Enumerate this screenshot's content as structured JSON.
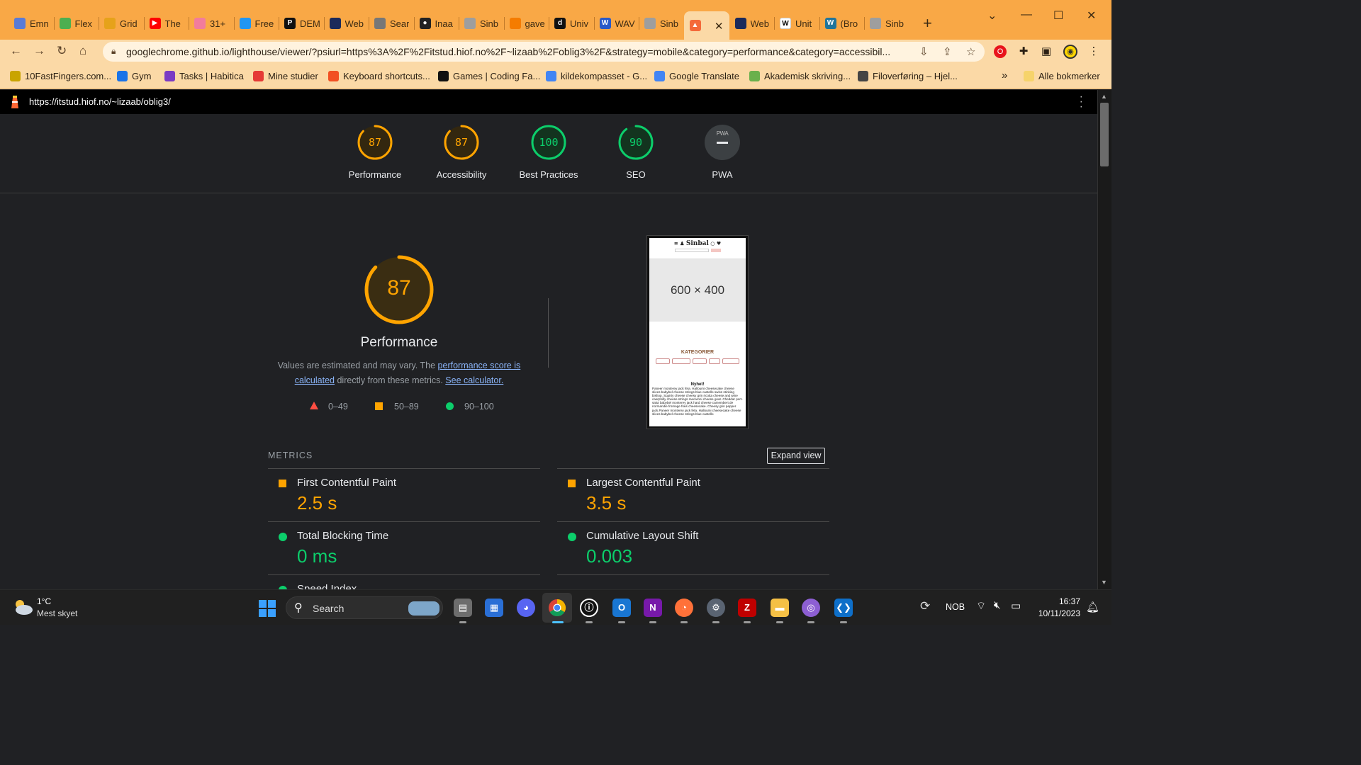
{
  "browser": {
    "tabs": [
      {
        "label": "Emn",
        "icon": "tab-favicon-emn"
      },
      {
        "label": "Flex",
        "icon": "tab-favicon-flex"
      },
      {
        "label": "Grid",
        "icon": "tab-favicon-grid"
      },
      {
        "label": "The",
        "icon": "youtube-icon"
      },
      {
        "label": "31+",
        "icon": "tab-favicon-pin"
      },
      {
        "label": "Free",
        "icon": "tab-favicon-free"
      },
      {
        "label": "DEM",
        "icon": "tab-favicon-dem"
      },
      {
        "label": "Web",
        "icon": "tab-favicon-web"
      },
      {
        "label": "Sear",
        "icon": "tab-favicon-search"
      },
      {
        "label": "Inaa",
        "icon": "github-icon"
      },
      {
        "label": "Sinb",
        "icon": "globe-icon"
      },
      {
        "label": "gave",
        "icon": "tab-favicon-trend"
      },
      {
        "label": "Univ",
        "icon": "tab-favicon-d"
      },
      {
        "label": "WAV",
        "icon": "tab-favicon-wav"
      },
      {
        "label": "Sinb",
        "icon": "globe-icon"
      },
      {
        "label": "",
        "icon": "lighthouse-icon"
      },
      {
        "label": "Web",
        "icon": "tab-favicon-web"
      },
      {
        "label": "Unit",
        "icon": "wikipedia-icon"
      },
      {
        "label": "(Bro",
        "icon": "wordpress-icon"
      },
      {
        "label": "Sinb",
        "icon": "globe-icon"
      }
    ],
    "active_tab_close": "✕",
    "new_tab": "+",
    "address": "googlechrome.github.io/lighthouse/viewer/?psiurl=https%3A%2F%2Fitstud.hiof.no%2F~lizaab%2Foblig3%2F&strategy=mobile&category=performance&category=accessibil...",
    "bookmarks": [
      "10FastFingers.com...",
      "Gym",
      "Tasks | Habitica",
      "Mine studier",
      "Keyboard shortcuts...",
      "Games | Coding Fa...",
      "kildekompasset - G...",
      "Google Translate",
      "Akademisk skriving...",
      "Filoverføring – Hjel..."
    ],
    "bookmarks_overflow": "»",
    "all_bookmarks": "Alle bokmerker"
  },
  "lighthouse": {
    "tested_url": "https://itstud.hiof.no/~lizaab/oblig3/",
    "categories": [
      {
        "score": "87",
        "label": "Performance",
        "value": 87,
        "rating": "average"
      },
      {
        "score": "87",
        "label": "Accessibility",
        "value": 87,
        "rating": "average"
      },
      {
        "score": "100",
        "label": "Best Practices",
        "value": 100,
        "rating": "pass"
      },
      {
        "score": "90",
        "label": "SEO",
        "value": 90,
        "rating": "pass"
      },
      {
        "score": "",
        "label": "PWA",
        "value": null,
        "rating": "na",
        "badge": "PWA"
      }
    ],
    "main_score": "87",
    "main_score_value": 87,
    "main_title": "Performance",
    "desc_before": "Values are estimated and may vary. The ",
    "desc_link1": "performance score is calculated",
    "desc_middle": " directly from these metrics. ",
    "desc_link2": "See calculator.",
    "legend": [
      "0–49",
      "50–89",
      "90–100"
    ],
    "screenshot": {
      "brand": "Sinbal",
      "placeholder": "600 × 400",
      "section": "KATEGORIER",
      "news_title": "Nyhet!",
      "news_text": "Paneer monterey jack feta. Halloumi cheesecake cheese slices babybel cheese strings blue castello swiss stinking bishop. Squirty cheese cheesy grin ricotta cheese and wine caerphilly cheese strings macaroni cheese goat. Cheddar port-salut babybel monterey jack hard cheese camembert de normandie fromage frais cheesecake. Cheesy grin pepper jack.Paneer monterey jack feta. Halloumi cheesecake cheese slices babybel cheese strings blue castello"
    },
    "metrics_heading": "METRICS",
    "expand_view": "Expand view",
    "metrics": [
      {
        "name": "First Contentful Paint",
        "value": "2.5 s",
        "rating": "average"
      },
      {
        "name": "Largest Contentful Paint",
        "value": "3.5 s",
        "rating": "average"
      },
      {
        "name": "Total Blocking Time",
        "value": "0 ms",
        "rating": "pass"
      },
      {
        "name": "Cumulative Layout Shift",
        "value": "0.003",
        "rating": "pass"
      },
      {
        "name": "Speed Index",
        "value": "",
        "rating": "pass"
      }
    ]
  },
  "colors": {
    "average": "#ffa400",
    "pass": "#0cce6b",
    "fail": "#ff4e42",
    "tabbar": "#f9a846",
    "toolbar": "#fbd9a6"
  },
  "taskbar": {
    "weather_temp": "1°C",
    "weather_desc": "Mest skyet",
    "search": "Search",
    "lang": "NOB",
    "time": "16:37",
    "date": "10/11/2023"
  }
}
